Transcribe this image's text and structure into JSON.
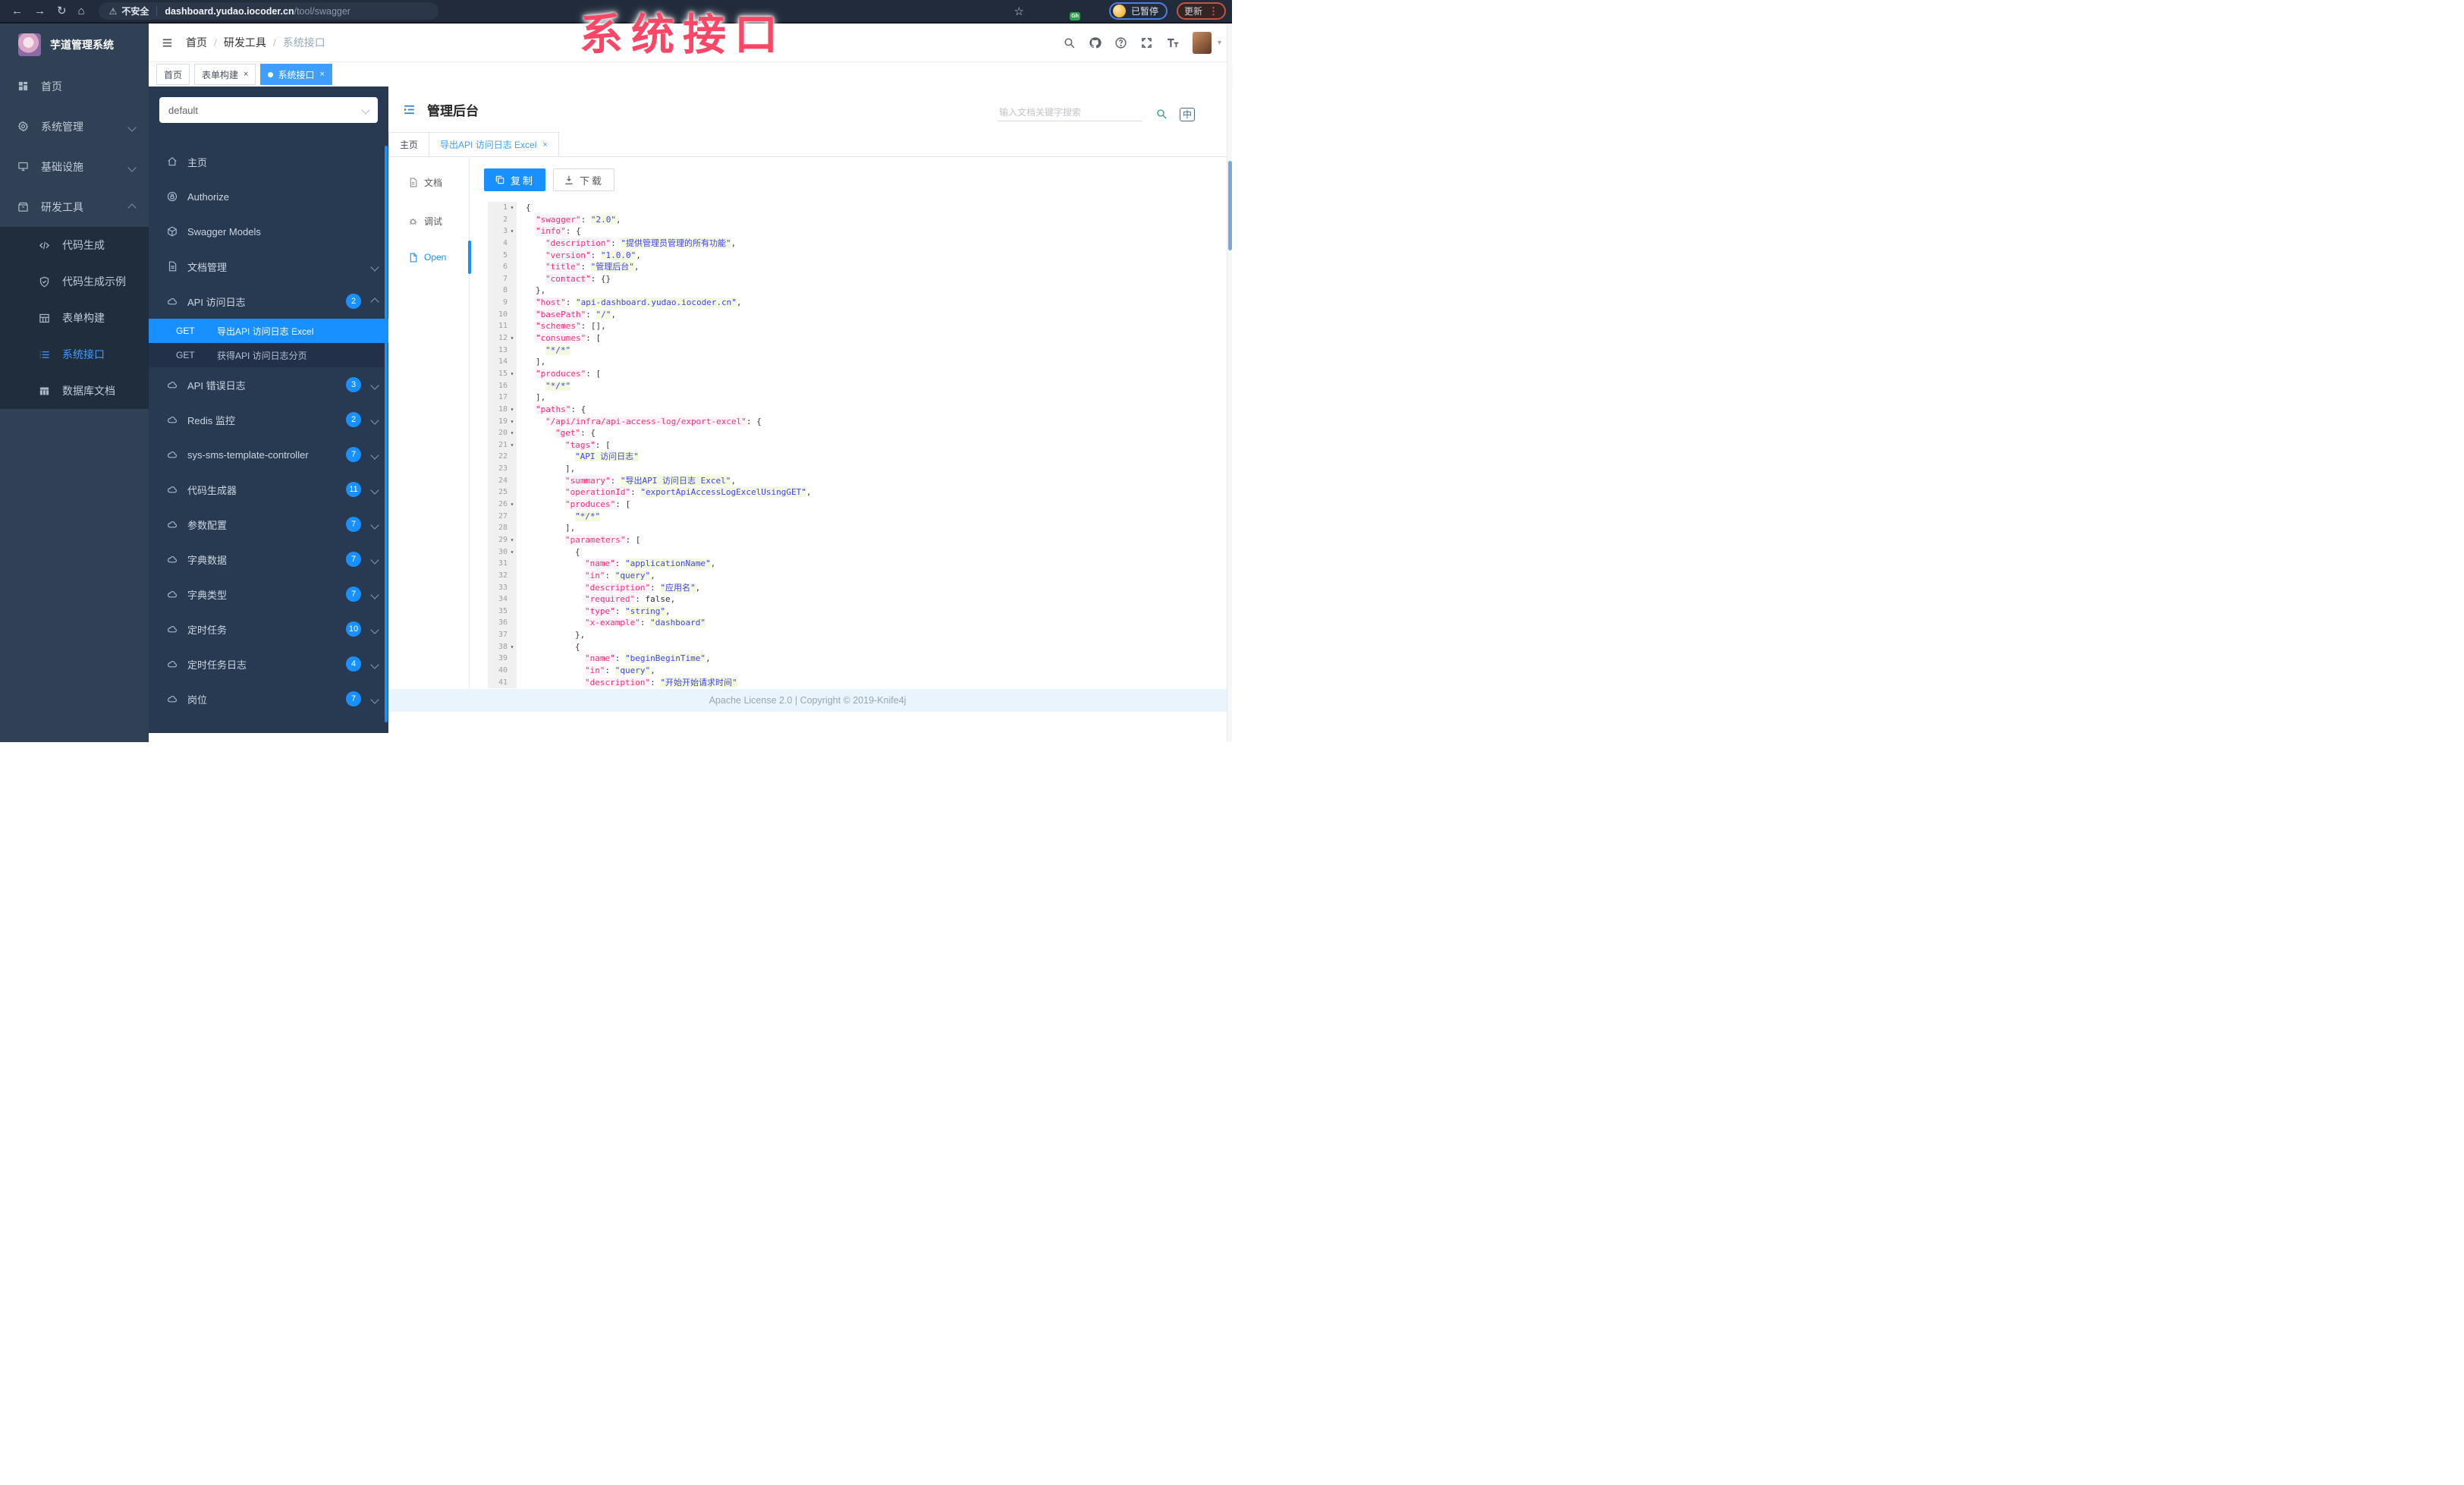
{
  "colors": {
    "accent": "#409eff",
    "knife4j_blue": "#1890ff",
    "sidebar_bg": "#304156",
    "sidebar_sub_bg": "#1f2d3d",
    "kside_bg": "#283a52",
    "overlay_pink": "#fb4766",
    "tag_active": "#409eff",
    "footer_bg": "#e9f4fc"
  },
  "browser": {
    "security": "不安全",
    "url_host": "dashboard.yudao.iocoder.cn",
    "url_path": "/tool/swagger",
    "paused_label": "已暂停",
    "update_label": "更新",
    "extensions": [
      {
        "name": "ext-orange-icon",
        "color": "#e8833a"
      },
      {
        "name": "ext-blue-drop-icon",
        "color": "#4a90e2"
      },
      {
        "name": "ext-green-check-icon",
        "color": "#35b558"
      },
      {
        "name": "ext-blue-grid-icon",
        "color": "#3b78e7"
      },
      {
        "name": "ext-github-icon",
        "color": "#1b2430",
        "badge": "Gh"
      },
      {
        "name": "ext-leaf-icon",
        "color": "#57a457"
      },
      {
        "name": "ext-white-icon",
        "color": "#e8eaed"
      }
    ]
  },
  "overlay": {
    "text": "系统接口"
  },
  "sidebar": {
    "brand": "芋道管理系统",
    "items": [
      {
        "label": "首页",
        "icon": "dashboard-icon"
      },
      {
        "label": "系统管理",
        "icon": "gear-icon",
        "chevron": "down"
      },
      {
        "label": "基础设施",
        "icon": "infra-icon",
        "chevron": "down"
      },
      {
        "label": "研发工具",
        "icon": "tools-icon",
        "chevron": "up",
        "open": true,
        "children": [
          {
            "label": "代码生成",
            "icon": "code-icon"
          },
          {
            "label": "代码生成示例",
            "icon": "shield-icon"
          },
          {
            "label": "表单构建",
            "icon": "form-icon"
          },
          {
            "label": "系统接口",
            "icon": "list-icon",
            "active": true
          },
          {
            "label": "数据库文档",
            "icon": "db-icon"
          }
        ]
      }
    ]
  },
  "navbar": {
    "breadcrumb": [
      "首页",
      "研发工具",
      "系统接口"
    ]
  },
  "tags": [
    {
      "label": "首页"
    },
    {
      "label": "表单构建",
      "closable": true
    },
    {
      "label": "系统接口",
      "closable": true,
      "active": true
    }
  ],
  "swagger_nav": {
    "group_select": "default",
    "items": [
      {
        "label": "主页",
        "icon": "home-icon"
      },
      {
        "label": "Authorize",
        "icon": "lock-icon"
      },
      {
        "label": "Swagger Models",
        "icon": "models-icon"
      },
      {
        "label": "文档管理",
        "icon": "doc-icon",
        "chevron": "down"
      },
      {
        "label": "API 访问日志",
        "icon": "cloud-icon",
        "badge": "2",
        "chevron": "up",
        "children": [
          {
            "method": "GET",
            "label": "导出API 访问日志 Excel",
            "active": true
          },
          {
            "method": "GET",
            "label": "获得API 访问日志分页"
          }
        ]
      },
      {
        "label": "API 错误日志",
        "icon": "cloud-icon",
        "badge": "3",
        "chevron": "down"
      },
      {
        "label": "Redis 监控",
        "icon": "cloud-icon",
        "badge": "2",
        "chevron": "down"
      },
      {
        "label": "sys-sms-template-controller",
        "icon": "cloud-icon",
        "badge": "7",
        "chevron": "down"
      },
      {
        "label": "代码生成器",
        "icon": "cloud-icon",
        "badge": "11",
        "chevron": "down"
      },
      {
        "label": "参数配置",
        "icon": "cloud-icon",
        "badge": "7",
        "chevron": "down"
      },
      {
        "label": "字典数据",
        "icon": "cloud-icon",
        "badge": "7",
        "chevron": "down"
      },
      {
        "label": "字典类型",
        "icon": "cloud-icon",
        "badge": "7",
        "chevron": "down"
      },
      {
        "label": "定时任务",
        "icon": "cloud-icon",
        "badge": "10",
        "chevron": "down"
      },
      {
        "label": "定时任务日志",
        "icon": "cloud-icon",
        "badge": "4",
        "chevron": "down"
      },
      {
        "label": "岗位",
        "icon": "cloud-icon",
        "badge": "7",
        "chevron": "down",
        "partial": true
      }
    ]
  },
  "doc": {
    "title": "管理后台",
    "search_placeholder": "输入文档关键字搜索",
    "lang_icon": "中",
    "tabs": [
      {
        "label": "主页"
      },
      {
        "label": "导出API 访问日志 Excel",
        "closable": true,
        "active": true
      }
    ],
    "mini_nav": [
      {
        "label": "文档",
        "icon": "file-text-icon"
      },
      {
        "label": "调试",
        "icon": "bug-icon"
      },
      {
        "label": "Open",
        "icon": "file-icon",
        "active": true
      }
    ],
    "copy_label": "复制",
    "download_label": "下载",
    "footer": "Apache License 2.0 | Copyright © 2019-Knife4j"
  },
  "code": {
    "lines": [
      {
        "f": 1,
        "i": 0,
        "s": [
          [
            "p",
            "{"
          ]
        ]
      },
      {
        "i": 1,
        "s": [
          [
            "k",
            "\"swagger\""
          ],
          [
            "p",
            ": "
          ],
          [
            "v",
            "\"2.0\""
          ],
          [
            "p",
            ","
          ]
        ]
      },
      {
        "f": 1,
        "i": 1,
        "s": [
          [
            "k",
            "\"info\""
          ],
          [
            "p",
            ": {"
          ]
        ]
      },
      {
        "i": 2,
        "s": [
          [
            "k",
            "\"description\""
          ],
          [
            "p",
            ": "
          ],
          [
            "v",
            "\"提供管理员管理的所有功能\""
          ],
          [
            "p",
            ","
          ]
        ]
      },
      {
        "i": 2,
        "s": [
          [
            "k",
            "\"version\""
          ],
          [
            "p",
            ": "
          ],
          [
            "v",
            "\"1.0.0\""
          ],
          [
            "p",
            ","
          ]
        ]
      },
      {
        "i": 2,
        "s": [
          [
            "k",
            "\"title\""
          ],
          [
            "p",
            ": "
          ],
          [
            "v",
            "\"管理后台\""
          ],
          [
            "p",
            ","
          ]
        ]
      },
      {
        "i": 2,
        "s": [
          [
            "k",
            "\"contact\""
          ],
          [
            "p",
            ": {}"
          ]
        ]
      },
      {
        "i": 1,
        "s": [
          [
            "p",
            "},"
          ]
        ]
      },
      {
        "i": 1,
        "s": [
          [
            "k",
            "\"host\""
          ],
          [
            "p",
            ": "
          ],
          [
            "v",
            "\"api-dashboard.yudao.iocoder.cn\""
          ],
          [
            "p",
            ","
          ]
        ]
      },
      {
        "i": 1,
        "s": [
          [
            "k",
            "\"basePath\""
          ],
          [
            "p",
            ": "
          ],
          [
            "v",
            "\"/\""
          ],
          [
            "p",
            ","
          ]
        ]
      },
      {
        "i": 1,
        "s": [
          [
            "k",
            "\"schemes\""
          ],
          [
            "p",
            ": [],"
          ]
        ]
      },
      {
        "f": 1,
        "i": 1,
        "s": [
          [
            "k",
            "\"consumes\""
          ],
          [
            "p",
            ": ["
          ]
        ]
      },
      {
        "i": 2,
        "s": [
          [
            "v",
            "\"*/*\""
          ]
        ]
      },
      {
        "i": 1,
        "s": [
          [
            "p",
            "],"
          ]
        ]
      },
      {
        "f": 1,
        "i": 1,
        "s": [
          [
            "k",
            "\"produces\""
          ],
          [
            "p",
            ": ["
          ]
        ]
      },
      {
        "i": 2,
        "s": [
          [
            "v",
            "\"*/*\""
          ]
        ]
      },
      {
        "i": 1,
        "s": [
          [
            "p",
            "],"
          ]
        ]
      },
      {
        "f": 1,
        "i": 1,
        "s": [
          [
            "k",
            "\"paths\""
          ],
          [
            "p",
            ": {"
          ]
        ]
      },
      {
        "f": 1,
        "i": 2,
        "s": [
          [
            "k",
            "\"/api/infra/api-access-log/export-excel\""
          ],
          [
            "p",
            ": {"
          ]
        ]
      },
      {
        "f": 1,
        "i": 3,
        "s": [
          [
            "k",
            "\"get\""
          ],
          [
            "p",
            ": {"
          ]
        ]
      },
      {
        "f": 1,
        "i": 4,
        "s": [
          [
            "k",
            "\"tags\""
          ],
          [
            "p",
            ": ["
          ]
        ]
      },
      {
        "i": 5,
        "s": [
          [
            "v",
            "\"API 访问日志\""
          ]
        ]
      },
      {
        "i": 4,
        "s": [
          [
            "p",
            "],"
          ]
        ]
      },
      {
        "i": 4,
        "s": [
          [
            "k",
            "\"summary\""
          ],
          [
            "p",
            ": "
          ],
          [
            "v",
            "\"导出API 访问日志 Excel\""
          ],
          [
            "p",
            ","
          ]
        ]
      },
      {
        "i": 4,
        "s": [
          [
            "k",
            "\"operationId\""
          ],
          [
            "p",
            ": "
          ],
          [
            "v",
            "\"exportApiAccessLogExcelUsingGET\""
          ],
          [
            "p",
            ","
          ]
        ]
      },
      {
        "f": 1,
        "i": 4,
        "s": [
          [
            "k",
            "\"produces\""
          ],
          [
            "p",
            ": ["
          ]
        ]
      },
      {
        "i": 5,
        "s": [
          [
            "v",
            "\"*/*\""
          ]
        ]
      },
      {
        "i": 4,
        "s": [
          [
            "p",
            "],"
          ]
        ]
      },
      {
        "f": 1,
        "i": 4,
        "s": [
          [
            "k",
            "\"parameters\""
          ],
          [
            "p",
            ": ["
          ]
        ]
      },
      {
        "f": 1,
        "i": 5,
        "s": [
          [
            "p",
            "{"
          ]
        ]
      },
      {
        "i": 6,
        "s": [
          [
            "k",
            "\"name\""
          ],
          [
            "p",
            ": "
          ],
          [
            "v",
            "\"applicationName\""
          ],
          [
            "p",
            ","
          ]
        ]
      },
      {
        "i": 6,
        "s": [
          [
            "k",
            "\"in\""
          ],
          [
            "p",
            ": "
          ],
          [
            "v",
            "\"query\""
          ],
          [
            "p",
            ","
          ]
        ]
      },
      {
        "i": 6,
        "s": [
          [
            "k",
            "\"description\""
          ],
          [
            "p",
            ": "
          ],
          [
            "v",
            "\"应用名\""
          ],
          [
            "p",
            ","
          ]
        ]
      },
      {
        "i": 6,
        "s": [
          [
            "k",
            "\"required\""
          ],
          [
            "p",
            ": "
          ],
          [
            "b",
            "false"
          ],
          [
            "p",
            ","
          ]
        ]
      },
      {
        "i": 6,
        "s": [
          [
            "k",
            "\"type\""
          ],
          [
            "p",
            ": "
          ],
          [
            "v",
            "\"string\""
          ],
          [
            "p",
            ","
          ]
        ]
      },
      {
        "i": 6,
        "s": [
          [
            "k",
            "\"x-example\""
          ],
          [
            "p",
            ": "
          ],
          [
            "v",
            "\"dashboard\""
          ]
        ]
      },
      {
        "i": 5,
        "s": [
          [
            "p",
            "},"
          ]
        ]
      },
      {
        "f": 1,
        "i": 5,
        "s": [
          [
            "p",
            "{"
          ]
        ]
      },
      {
        "i": 6,
        "s": [
          [
            "k",
            "\"name\""
          ],
          [
            "p",
            ": "
          ],
          [
            "v",
            "\"beginBeginTime\""
          ],
          [
            "p",
            ","
          ]
        ]
      },
      {
        "i": 6,
        "s": [
          [
            "k",
            "\"in\""
          ],
          [
            "p",
            ": "
          ],
          [
            "v",
            "\"query\""
          ],
          [
            "p",
            ","
          ]
        ]
      },
      {
        "i": 6,
        "s": [
          [
            "k",
            "\"description\""
          ],
          [
            "p",
            ": "
          ],
          [
            "v",
            "\"开始开始请求时间\""
          ]
        ]
      }
    ]
  }
}
